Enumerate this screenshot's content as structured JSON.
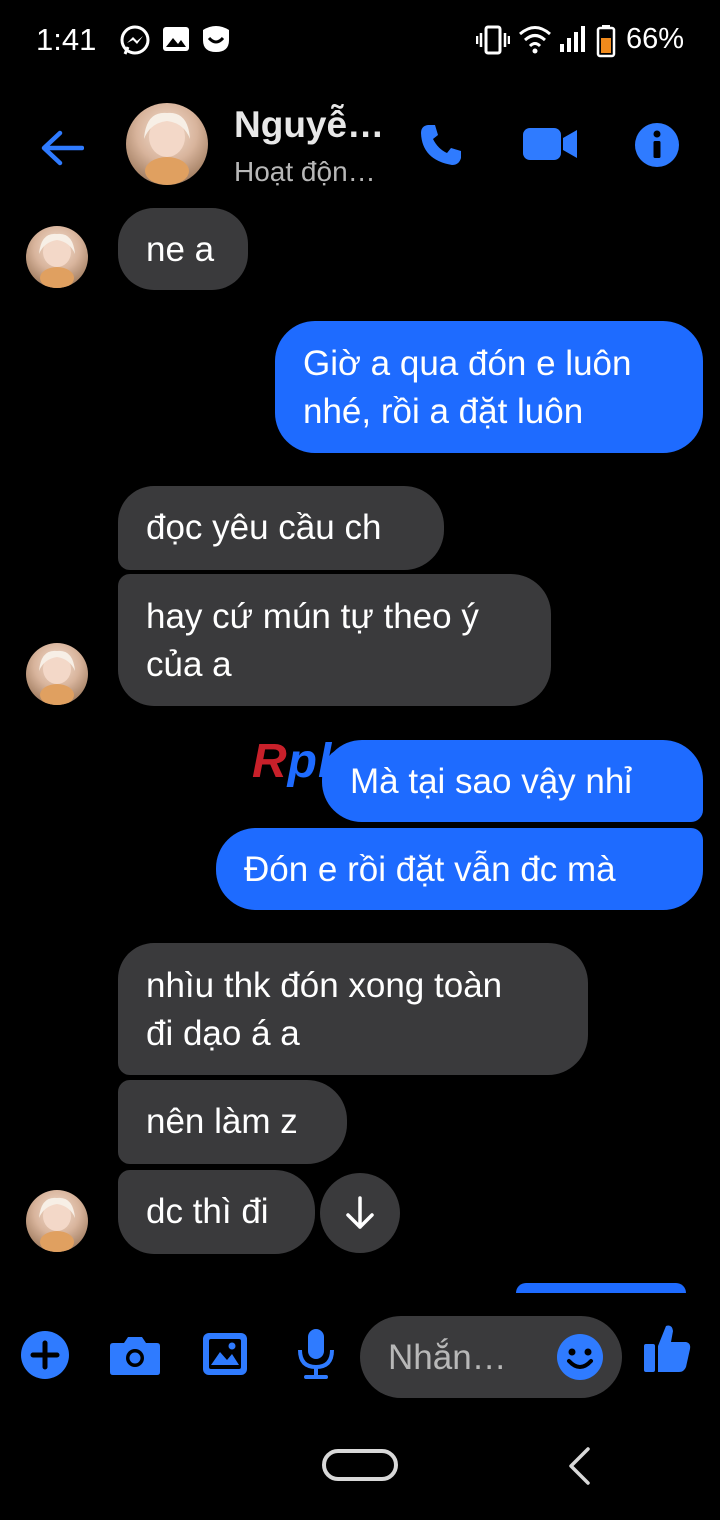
{
  "status_bar": {
    "time": "1:41",
    "battery_percent": "66%",
    "left_icons": [
      "messenger-icon",
      "gallery-icon",
      "app-icon"
    ],
    "right_icons": [
      "vibrate-icon",
      "wifi-icon",
      "signal-icon",
      "battery-icon"
    ]
  },
  "header": {
    "contact_name": "Nguyễ…",
    "contact_status": "Hoạt độn…",
    "icons": [
      "back-arrow-icon",
      "phone-icon",
      "video-camera-icon",
      "info-icon"
    ]
  },
  "messages": [
    {
      "side": "received",
      "lines": [
        "ne a"
      ]
    },
    {
      "side": "sent",
      "lines": [
        "Giờ a qua đón e luôn",
        "nhé, rồi a đặt luôn"
      ]
    },
    {
      "side": "received",
      "lines": [
        "đọc yêu cầu ch"
      ]
    },
    {
      "side": "received",
      "lines": [
        "hay cứ mún tự theo ý",
        "của a"
      ]
    },
    {
      "side": "sent",
      "lines": [
        "Mà tại sao vậy nhỉ"
      ]
    },
    {
      "side": "sent",
      "lines": [
        "Đón e rồi đặt vẫn đc mà"
      ]
    },
    {
      "side": "received",
      "lines": [
        "nhìu thk đón xong toàn",
        "đi dạo á a"
      ]
    },
    {
      "side": "received",
      "lines": [
        "nên làm z"
      ]
    },
    {
      "side": "received",
      "lines": [
        "dc thì đi"
      ]
    }
  ],
  "watermark": {
    "part1": "R",
    "part2": "phang"
  },
  "composer": {
    "placeholder": "Nhắn…",
    "icons": [
      "plus-icon",
      "camera-icon",
      "image-icon",
      "microphone-icon",
      "emoji-icon",
      "thumbs-up-icon"
    ]
  },
  "colors": {
    "accent": "#1e6bff",
    "received_bubble": "#3a3a3c",
    "background": "#000000"
  }
}
